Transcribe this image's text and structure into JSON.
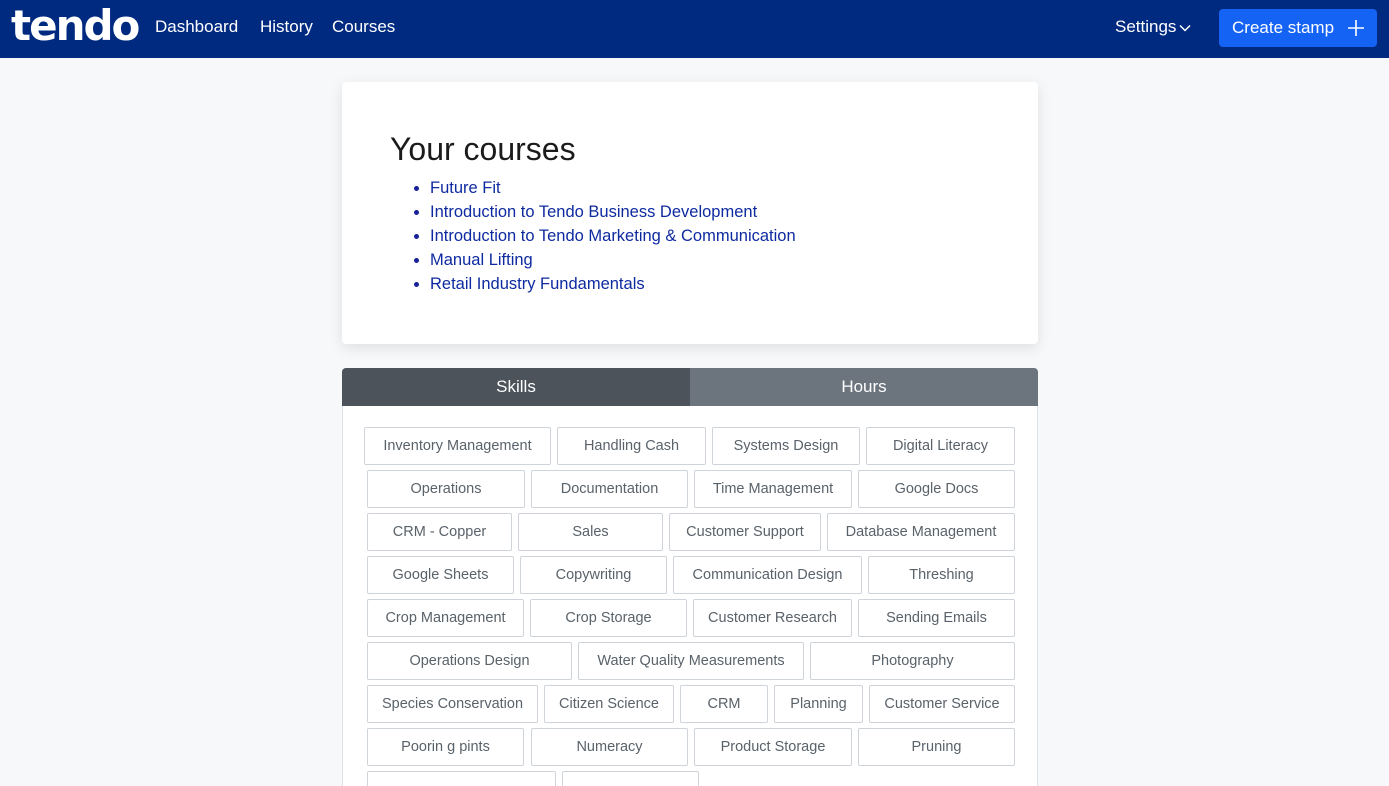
{
  "navbar": {
    "logo": "tendo",
    "links": [
      "Dashboard",
      "History",
      "Courses"
    ],
    "settings_label": "Settings",
    "create_label": "Create stamp"
  },
  "courses": {
    "heading": "Your courses",
    "items": [
      "Future Fit",
      "Introduction to Tendo Business Development",
      "Introduction to Tendo Marketing & Communication",
      "Manual Lifting",
      "Retail Industry Fundamentals"
    ]
  },
  "tabs": {
    "skills": "Skills",
    "hours": "Hours",
    "active": "Skills"
  },
  "skills": [
    "Inventory Management",
    "Handling Cash",
    "Systems Design",
    "Digital Literacy",
    "Operations",
    "Documentation",
    "Time Management",
    "Google Docs",
    "CRM - Copper",
    "Sales",
    "Customer Support",
    "Database Management",
    "Google Sheets",
    "Copywriting",
    "Communication Design",
    "Threshing",
    "Crop Management",
    "Crop Storage",
    "Customer Research",
    "Sending Emails",
    "Operations Design",
    "Water Quality Measurements",
    "Photography",
    "Species Conservation",
    "Citizen Science",
    "CRM",
    "Planning",
    "Customer Service",
    "Poorin g pints",
    "Numeracy",
    "Product Storage",
    "Pruning",
    "",
    ""
  ],
  "colors": {
    "navbar": "#002a80",
    "create_button": "#1463f5",
    "link": "#0e2aa0",
    "tab_active": "#4d535b",
    "tab_inactive": "#6c757d"
  }
}
